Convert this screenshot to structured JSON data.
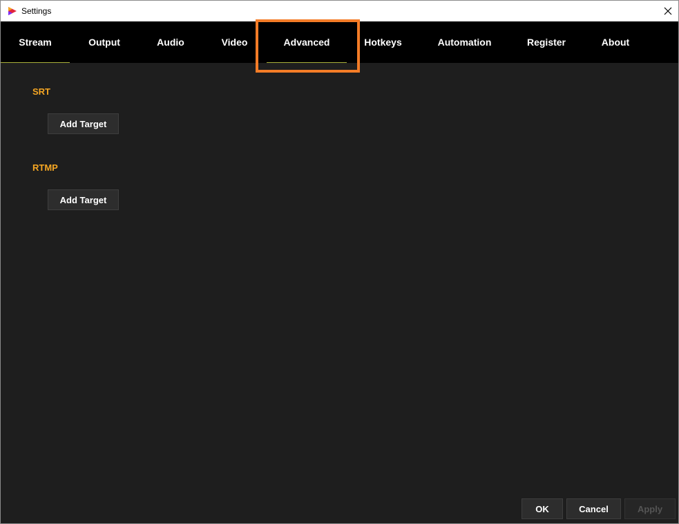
{
  "window": {
    "title": "Settings"
  },
  "tabs": [
    {
      "label": "Stream"
    },
    {
      "label": "Output"
    },
    {
      "label": "Audio"
    },
    {
      "label": "Video"
    },
    {
      "label": "Advanced"
    },
    {
      "label": "Hotkeys"
    },
    {
      "label": "Automation"
    },
    {
      "label": "Register"
    },
    {
      "label": "About"
    }
  ],
  "sections": {
    "srt": {
      "label": "SRT",
      "add_label": "Add Target"
    },
    "rtmp": {
      "label": "RTMP",
      "add_label": "Add Target"
    }
  },
  "footer": {
    "ok_label": "OK",
    "cancel_label": "Cancel",
    "apply_label": "Apply"
  },
  "colors": {
    "accent": "#f5a623",
    "highlight": "#f47c27",
    "tab_underline": "#aab23a",
    "background": "#1e1e1e"
  }
}
